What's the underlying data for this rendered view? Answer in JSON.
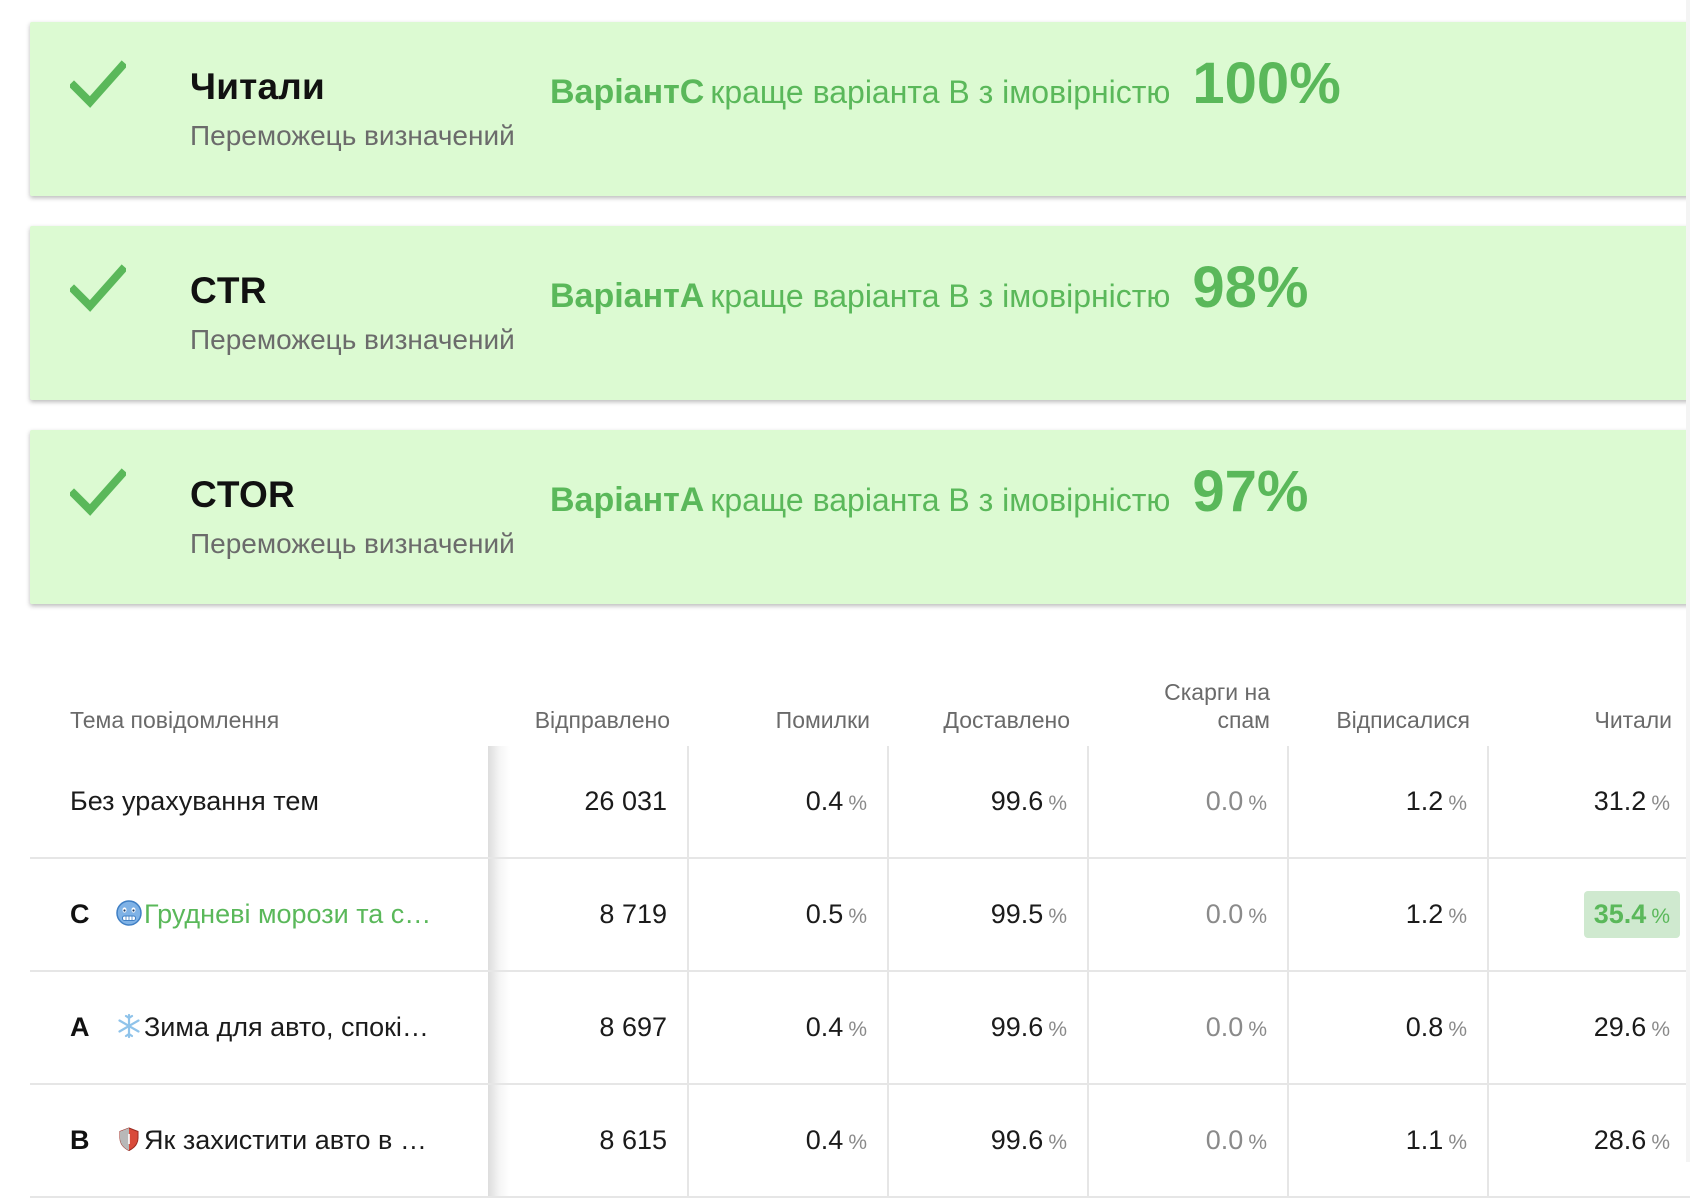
{
  "colors": {
    "card_bg": "#dcfad2",
    "accent_green": "#5ab85a",
    "winner_highlight": "#cfe9cf"
  },
  "cards": [
    {
      "metric": "Читали",
      "status": "Переможець визначений",
      "variant": "ВаріантC",
      "phrase": "краще варіанта B з імовірністю",
      "probability": "100%",
      "icon": "check-icon"
    },
    {
      "metric": "CTR",
      "status": "Переможець визначений",
      "variant": "ВаріантA",
      "phrase": "краще варіанта B з імовірністю",
      "probability": "98%",
      "icon": "check-icon"
    },
    {
      "metric": "CTOR",
      "status": "Переможець визначений",
      "variant": "ВаріантA",
      "phrase": "краще варіанта B з імовірністю",
      "probability": "97%",
      "icon": "check-icon"
    }
  ],
  "table": {
    "headers": {
      "subject": "Тема повідомлення",
      "sent": "Відправлено",
      "errors": "Помилки",
      "delivered": "Доставлено",
      "spam_line1": "Скарги на",
      "spam_line2": "спам",
      "unsub": "Відписалися",
      "read": "Читали"
    },
    "pct_sign": "%",
    "rows": [
      {
        "letter": "",
        "emoji": "",
        "subject": "Без урахування тем",
        "sent": "26 031",
        "errors": "0.4",
        "delivered": "99.6",
        "spam": "0.0",
        "unsub": "1.2",
        "read": "31.2"
      },
      {
        "letter": "C",
        "emoji": "cold-face-emoji",
        "subject": "Грудневі морози та с…",
        "sent": "8 719",
        "errors": "0.5",
        "delivered": "99.5",
        "spam": "0.0",
        "unsub": "1.2",
        "read": "35.4",
        "winner": true
      },
      {
        "letter": "A",
        "emoji": "snowflake-emoji",
        "subject": "Зима для авто, спокі…",
        "sent": "8 697",
        "errors": "0.4",
        "delivered": "99.6",
        "spam": "0.0",
        "unsub": "0.8",
        "read": "29.6"
      },
      {
        "letter": "B",
        "emoji": "shield-emoji",
        "subject": "Як захистити авто в …",
        "sent": "8 615",
        "errors": "0.4",
        "delivered": "99.6",
        "spam": "0.0",
        "unsub": "1.1",
        "read": "28.6"
      }
    ]
  }
}
